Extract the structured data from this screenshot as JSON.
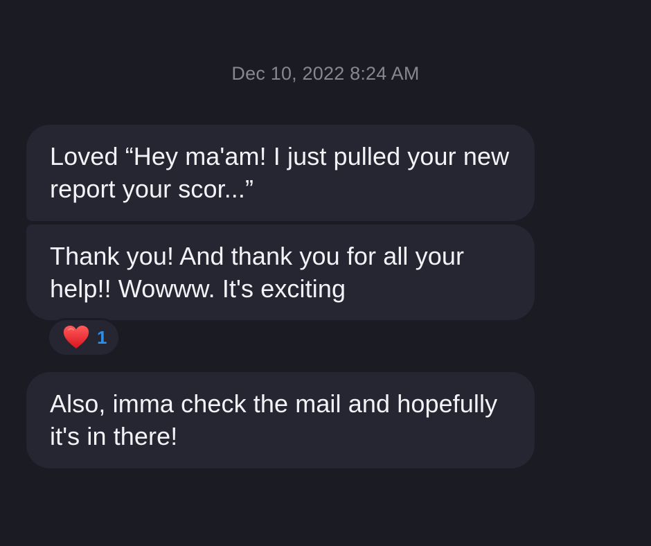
{
  "conversation": {
    "timestamp": "Dec 10, 2022 8:24 AM",
    "messages": [
      {
        "text": "Loved “Hey ma'am! I just pulled your new report your scor...”"
      },
      {
        "text": "Thank you! And thank you for all your help!! Wowww. It's exciting",
        "reaction": {
          "icon": "heart-icon",
          "count": "1",
          "color": "#e61e2b"
        }
      },
      {
        "text": "Also, imma check the mail and hopefully it's in there!"
      }
    ]
  },
  "colors": {
    "background": "#1b1b24",
    "bubble": "#262633",
    "text": "#f3f3f7",
    "timestamp": "#878793",
    "reaction_count": "#2f8fe8"
  }
}
